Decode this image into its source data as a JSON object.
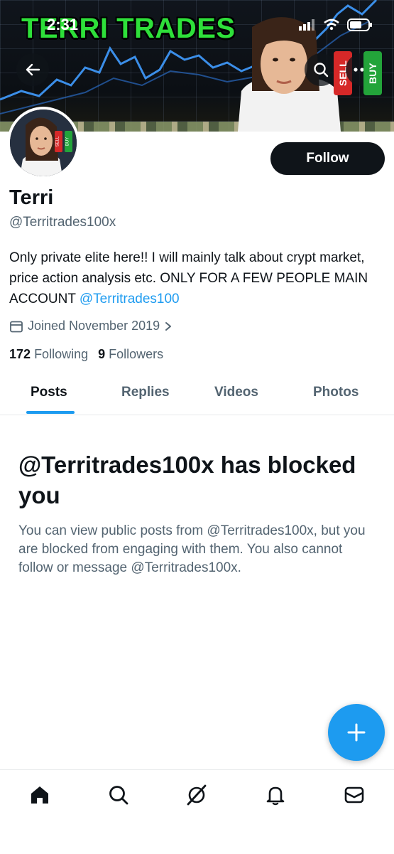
{
  "status_bar": {
    "time": "2:31"
  },
  "banner": {
    "title": "TERRI TRADES",
    "sell_label": "SELL",
    "buy_label": "BUY"
  },
  "avatar": {
    "sell_label": "SELL",
    "buy_label": "BUY"
  },
  "profile": {
    "follow_label": "Follow",
    "name": "Terri",
    "handle": "@Territrades100x",
    "bio_text": "Only private elite here!! I will mainly talk about crypt market, price action analysis etc. ONLY FOR A FEW PEOPLE MAIN ACCOUNT ",
    "bio_mention": "@Territrades100",
    "joined": "Joined November 2019",
    "following_count": "172",
    "following_label": "Following",
    "followers_count": "9",
    "followers_label": "Followers"
  },
  "tabs": [
    {
      "label": "Posts"
    },
    {
      "label": "Replies"
    },
    {
      "label": "Videos"
    },
    {
      "label": "Photos"
    }
  ],
  "blocked": {
    "title": "@Territrades100x has blocked you",
    "description": "You can view public posts from @Territrades100x, but you are blocked from engaging with them. You also cannot follow or message @Territrades100x."
  },
  "bottom_nav": [
    "home-icon",
    "search-icon",
    "grok-icon",
    "notifications-icon",
    "messages-icon"
  ],
  "colors": {
    "accent": "#1d9bf0",
    "text": "#0f1419",
    "muted": "#536471",
    "banner_title": "#2ee03a"
  }
}
